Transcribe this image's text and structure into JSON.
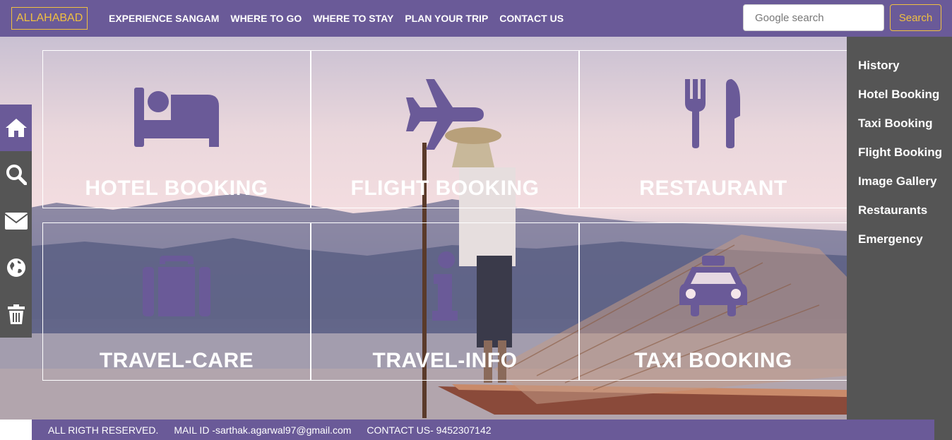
{
  "navbar": {
    "brand": "ALLAHABAD",
    "links": [
      "EXPERIENCE SANGAM",
      "WHERE TO GO",
      "WHERE TO STAY",
      "PLAN YOUR TRIP",
      "CONTACT US"
    ],
    "search_placeholder": "Google search",
    "search_button": "Search"
  },
  "tiles": [
    {
      "label": "HOTEL BOOKING",
      "icon": "bed-icon"
    },
    {
      "label": "FLIGHT BOOKING",
      "icon": "plane-icon"
    },
    {
      "label": "RESTAURANT",
      "icon": "cutlery-icon"
    },
    {
      "label": "TRAVEL-CARE",
      "icon": "suitcase-icon"
    },
    {
      "label": "TRAVEL-INFO",
      "icon": "info-icon"
    },
    {
      "label": "TAXI BOOKING",
      "icon": "taxi-icon"
    }
  ],
  "side_icons": [
    "home-icon",
    "search-icon",
    "mail-icon",
    "globe-icon",
    "trash-icon"
  ],
  "right_menu": [
    "History",
    "Hotel Booking",
    "Taxi Booking",
    "Flight Booking",
    "Image Gallery",
    "Restaurants",
    "Emergency"
  ],
  "footer": {
    "rights": "ALL RIGTH RESERVED.",
    "mail": "MAIL ID -sarthak.agarwal97@gmail.com",
    "contact": "CONTACT US- 9452307142"
  },
  "colors": {
    "primary": "#6a5a98",
    "accent": "#f0c040",
    "sidebar": "#555555"
  }
}
